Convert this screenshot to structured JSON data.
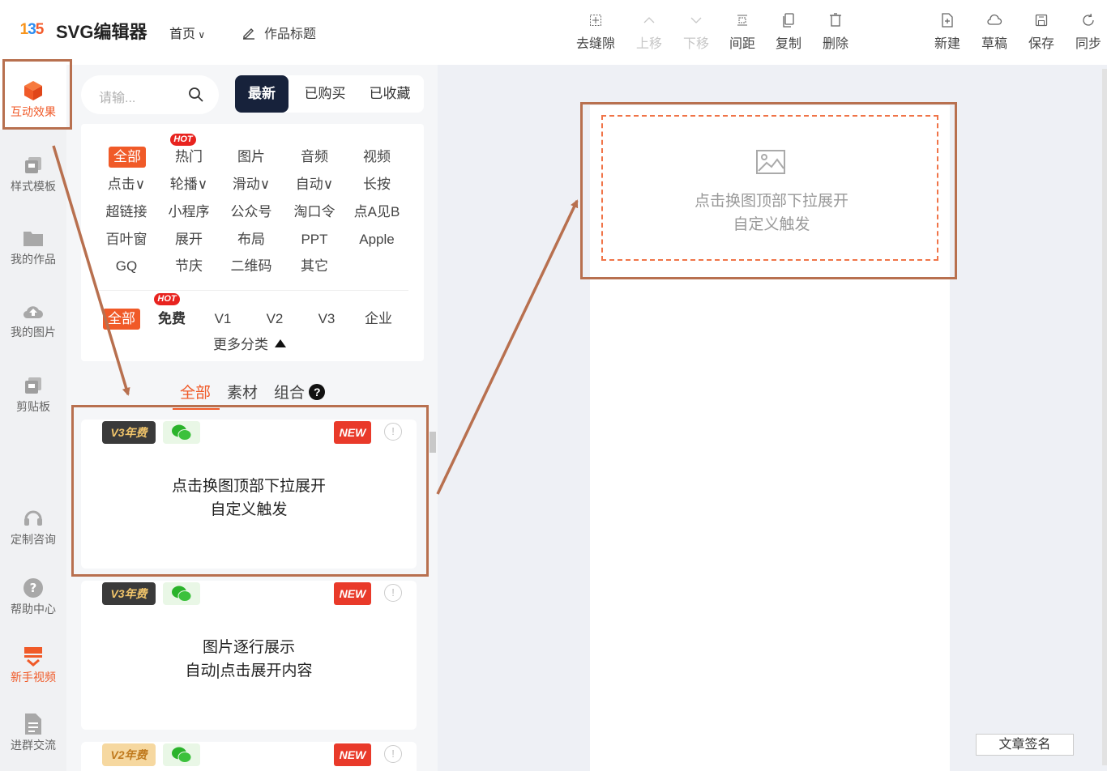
{
  "header": {
    "logo": {
      "a": "1",
      "b": "3",
      "c": "5"
    },
    "brand": "SVG编辑器",
    "home": "首页",
    "title_edit": "作品标题",
    "tools": [
      {
        "name": "remove-gap",
        "label": "去缝隙",
        "icon": "grid-icon",
        "disabled": false
      },
      {
        "name": "move-up",
        "label": "上移",
        "icon": "chevron-up-icon",
        "disabled": true
      },
      {
        "name": "move-down",
        "label": "下移",
        "icon": "chevron-down-icon",
        "disabled": true
      },
      {
        "name": "spacing",
        "label": "间距",
        "icon": "spacing-icon",
        "disabled": false
      },
      {
        "name": "copy",
        "label": "复制",
        "icon": "copy-icon",
        "disabled": false
      },
      {
        "name": "delete",
        "label": "删除",
        "icon": "trash-icon",
        "disabled": false
      },
      {
        "name": "new",
        "label": "新建",
        "icon": "new-file-icon",
        "disabled": false
      },
      {
        "name": "draft",
        "label": "草稿",
        "icon": "cloud-icon",
        "disabled": false
      },
      {
        "name": "save",
        "label": "保存",
        "icon": "save-icon",
        "disabled": false
      },
      {
        "name": "sync",
        "label": "同步",
        "icon": "sync-icon",
        "disabled": false
      }
    ]
  },
  "leftnav": [
    {
      "label": "互动效果",
      "icon": "cube-icon"
    },
    {
      "label": "样式模板",
      "icon": "template-icon"
    },
    {
      "label": "我的作品",
      "icon": "folder-icon"
    },
    {
      "label": "我的图片",
      "icon": "cloud-upload-icon"
    },
    {
      "label": "剪贴板",
      "icon": "clipboard-icon"
    },
    {
      "label": "定制咨询",
      "icon": "headset-icon"
    },
    {
      "label": "帮助中心",
      "icon": "help-icon"
    },
    {
      "label": "新手视频",
      "icon": "video-icon"
    },
    {
      "label": "进群交流",
      "icon": "document-icon"
    }
  ],
  "panel": {
    "search_placeholder": "请输...",
    "segtabs": [
      "最新",
      "已购买",
      "已收藏"
    ],
    "categories_row1": [
      "全部",
      "热门",
      "图片",
      "音频",
      "视频"
    ],
    "categories_row2": [
      "点击∨",
      "轮播∨",
      "滑动∨",
      "自动∨",
      "长按"
    ],
    "categories_row3": [
      "超链接",
      "小程序",
      "公众号",
      "淘口令",
      "点A见B"
    ],
    "categories_row4": [
      "百叶窗",
      "展开",
      "布局",
      "PPT",
      "Apple"
    ],
    "categories_row5": [
      "GQ",
      "节庆",
      "二维码",
      "其它"
    ],
    "pricing": [
      "全部",
      "免费",
      "V1",
      "V2",
      "V3",
      "企业"
    ],
    "hot_label": "HOT",
    "more": "更多分类",
    "subtabs": [
      "全部",
      "素材",
      "组合"
    ],
    "qmark": "?",
    "cards": [
      {
        "version": "V3年费",
        "new": "NEW",
        "info": "!",
        "line1": "点击换图顶部下拉展开",
        "line2": "自定义触发"
      },
      {
        "version": "V3年费",
        "new": "NEW",
        "info": "!",
        "line1": "图片逐行展示",
        "line2": "自动|点击展开内容"
      },
      {
        "version": "V2年费",
        "new": "NEW",
        "info": "!",
        "line1": "",
        "line2": ""
      }
    ]
  },
  "canvas": {
    "placeholder_line1": "点击换图顶部下拉展开",
    "placeholder_line2": "自定义触发",
    "sign_button": "文章签名"
  },
  "colors": {
    "accent": "#f05a28",
    "annotation": "#b8704f",
    "dark_tab": "#17223b"
  }
}
